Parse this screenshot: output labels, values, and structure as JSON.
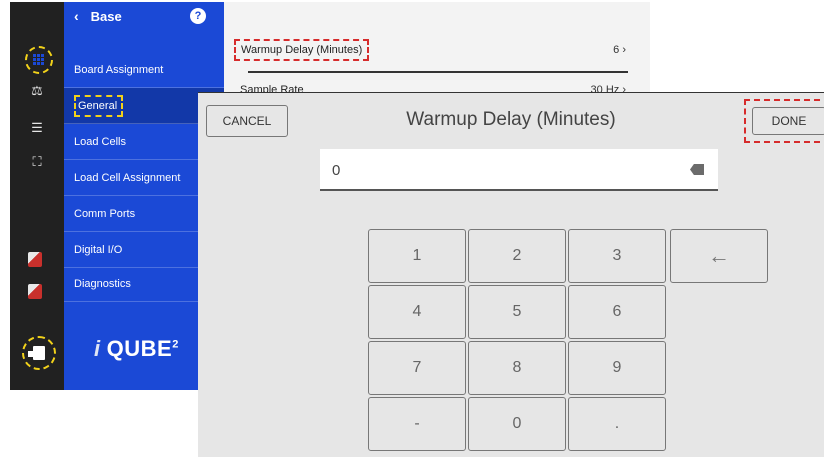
{
  "sidebar": {
    "back_label": "Base",
    "help_icon": "?",
    "items": [
      {
        "label": "Board Assignment"
      },
      {
        "label": "General"
      },
      {
        "label": "Load Cells"
      },
      {
        "label": "Load Cell Assignment"
      },
      {
        "label": "Comm Ports"
      },
      {
        "label": "Digital I/O"
      },
      {
        "label": "Diagnostics"
      }
    ],
    "active_item": "General",
    "logo_text": "QUBE",
    "logo_sup": "2"
  },
  "rail": {
    "icons": [
      "grid-icon",
      "scale-icon",
      "list-icon",
      "network-icon",
      "cup-icon",
      "cup-icon",
      "export-icon"
    ]
  },
  "settings": {
    "rows": [
      {
        "label": "Warmup Delay (Minutes)",
        "value": "6 ›"
      },
      {
        "label": "Sample Rate",
        "value": "30 Hz ›"
      }
    ]
  },
  "modal": {
    "title": "Warmup Delay (Minutes)",
    "cancel_label": "CANCEL",
    "done_label": "DONE",
    "input_value": "0",
    "keys": [
      "1",
      "2",
      "3",
      "4",
      "5",
      "6",
      "7",
      "8",
      "9",
      "-",
      "0",
      "."
    ],
    "backspace_key": "←"
  },
  "colors": {
    "accent": "#1b49d6",
    "active_nav": "#1238a8",
    "highlight_yellow": "#f2d21a",
    "highlight_red": "#d62b2b",
    "rail_bg": "#212121",
    "modal_bg": "#e6e6e6"
  }
}
